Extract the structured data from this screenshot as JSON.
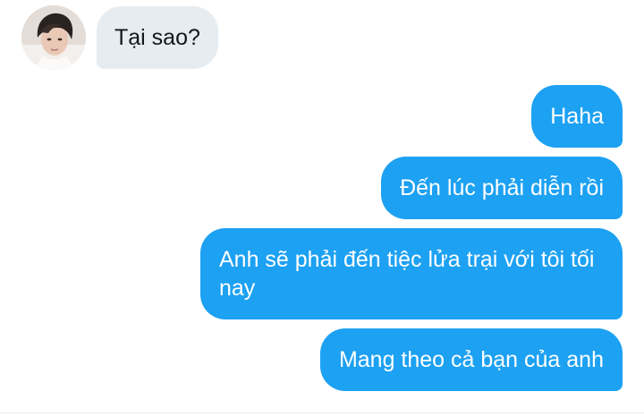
{
  "conversation": {
    "messages": [
      {
        "sender": "contact",
        "text": "Tại sao?"
      },
      {
        "sender": "me",
        "text": "Haha"
      },
      {
        "sender": "me",
        "text": "Đến lúc phải diễn rồi"
      },
      {
        "sender": "me",
        "text": "Anh sẽ phải đến tiệc lửa trại với tôi tối nay"
      },
      {
        "sender": "me",
        "text": "Mang theo cả bạn của anh"
      }
    ]
  },
  "colors": {
    "outgoing_bubble": "#1da1f2",
    "incoming_bubble": "#e6ecf0",
    "incoming_text": "#14171a",
    "outgoing_text": "#ffffff"
  },
  "icons": {
    "avatar": "contact-avatar-photo"
  }
}
